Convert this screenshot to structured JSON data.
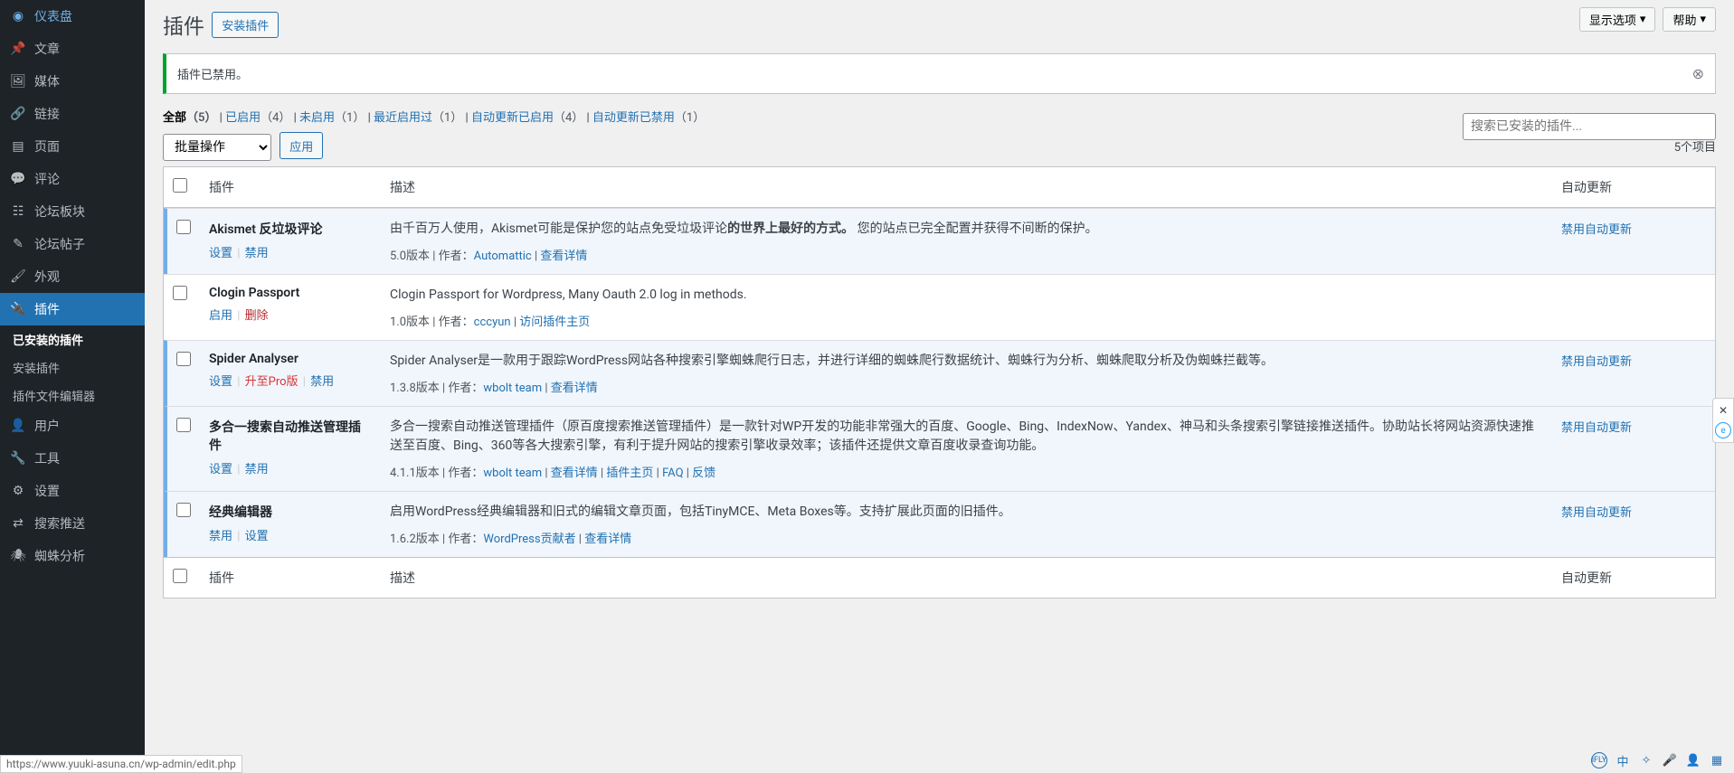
{
  "sidebar": {
    "items": [
      {
        "icon": "dashboard",
        "label": "仪表盘"
      },
      {
        "icon": "pin",
        "label": "文章"
      },
      {
        "icon": "media",
        "label": "媒体"
      },
      {
        "icon": "link",
        "label": "链接"
      },
      {
        "icon": "page",
        "label": "页面"
      },
      {
        "icon": "comment",
        "label": "评论"
      },
      {
        "icon": "forum-board",
        "label": "论坛板块"
      },
      {
        "icon": "forum-post",
        "label": "论坛帖子"
      },
      {
        "icon": "appearance",
        "label": "外观"
      },
      {
        "icon": "plugin",
        "label": "插件",
        "current": true
      },
      {
        "icon": "user",
        "label": "用户"
      },
      {
        "icon": "tool",
        "label": "工具"
      },
      {
        "icon": "settings",
        "label": "设置"
      },
      {
        "icon": "search-push",
        "label": "搜索推送"
      },
      {
        "icon": "spider",
        "label": "蜘蛛分析"
      }
    ],
    "submenu": [
      {
        "label": "已安装的插件",
        "current": true
      },
      {
        "label": "安装插件"
      },
      {
        "label": "插件文件编辑器"
      }
    ]
  },
  "topButtons": {
    "screenOptions": "显示选项",
    "help": "帮助"
  },
  "page": {
    "title": "插件",
    "addNew": "安装插件",
    "notice": "插件已禁用。",
    "searchPlaceholder": "搜索已安装的插件...",
    "itemCount": "5个项目"
  },
  "filters": [
    {
      "label": "全部",
      "count": "（5）",
      "current": true
    },
    {
      "label": "已启用",
      "count": "（4）"
    },
    {
      "label": "未启用",
      "count": "（1）"
    },
    {
      "label": "最近启用过",
      "count": "（1）"
    },
    {
      "label": "自动更新已启用",
      "count": "（4）"
    },
    {
      "label": "自动更新已禁用",
      "count": "（1）"
    }
  ],
  "bulk": {
    "placeholder": "批量操作",
    "apply": "应用"
  },
  "columns": {
    "plugin": "插件",
    "description": "描述",
    "autoUpdate": "自动更新"
  },
  "plugins": [
    {
      "active": true,
      "name": "Akismet 反垃圾评论",
      "actions": [
        {
          "label": "设置"
        },
        {
          "label": "禁用"
        }
      ],
      "desc_pre": "由千百万人使用，Akismet可能是保护您的站点免受垃圾评论",
      "desc_bold": "的世界上最好的方式。",
      "desc_post": " 您的站点已完全配置并获得不间断的保护。",
      "version": "5.0版本",
      "authorLabel": "作者：",
      "author": "Automattic",
      "metaLinks": [
        {
          "label": "查看详情"
        }
      ],
      "autoUpdate": "禁用自动更新"
    },
    {
      "active": false,
      "name": "Clogin Passport",
      "actions": [
        {
          "label": "启用"
        },
        {
          "label": "删除",
          "delete": true
        }
      ],
      "desc_pre": "Clogin Passport for Wordpress, Many Oauth 2.0 log in methods.",
      "version": "1.0版本",
      "authorLabel": "作者：",
      "author": "cccyun",
      "metaLinks": [
        {
          "label": "访问插件主页"
        }
      ]
    },
    {
      "active": true,
      "name": "Spider Analyser",
      "actions": [
        {
          "label": "设置"
        },
        {
          "label": "升至Pro版",
          "highlight": true
        },
        {
          "label": "禁用"
        }
      ],
      "desc_pre": "Spider Analyser是一款用于跟踪WordPress网站各种搜索引擎蜘蛛爬行日志，并进行详细的蜘蛛爬行数据统计、蜘蛛行为分析、蜘蛛爬取分析及伪蜘蛛拦截等。",
      "version": "1.3.8版本",
      "authorLabel": "作者：",
      "author": "wbolt team",
      "metaLinks": [
        {
          "label": "查看详情"
        }
      ],
      "autoUpdate": "禁用自动更新"
    },
    {
      "active": true,
      "name": "多合一搜索自动推送管理插件",
      "actions": [
        {
          "label": "设置"
        },
        {
          "label": "禁用"
        }
      ],
      "desc_pre": "多合一搜索自动推送管理插件（原百度搜索推送管理插件）是一款针对WP开发的功能非常强大的百度、Google、Bing、IndexNow、Yandex、神马和头条搜索引擎链接推送插件。协助站长将网站资源快速推送至百度、Bing、360等各大搜索引擎，有利于提升网站的搜索引擎收录效率；该插件还提供文章百度收录查询功能。",
      "version": "4.1.1版本",
      "authorLabel": "作者：",
      "author": "wbolt team",
      "metaLinks": [
        {
          "label": "查看详情"
        },
        {
          "label": "插件主页"
        },
        {
          "label": "FAQ"
        },
        {
          "label": "反馈"
        }
      ],
      "autoUpdate": "禁用自动更新"
    },
    {
      "active": true,
      "name": "经典编辑器",
      "actions": [
        {
          "label": "禁用"
        },
        {
          "label": "设置"
        }
      ],
      "desc_pre": "启用WordPress经典编辑器和旧式的编辑文章页面，包括TinyMCE、Meta Boxes等。支持扩展此页面的旧插件。",
      "version": "1.6.2版本",
      "authorLabel": "作者：",
      "author": "WordPress贡献者",
      "metaLinks": [
        {
          "label": "查看详情"
        }
      ],
      "autoUpdate": "禁用自动更新"
    }
  ],
  "statusUrl": "https://www.yuuki-asuna.cn/wp-admin/edit.php"
}
